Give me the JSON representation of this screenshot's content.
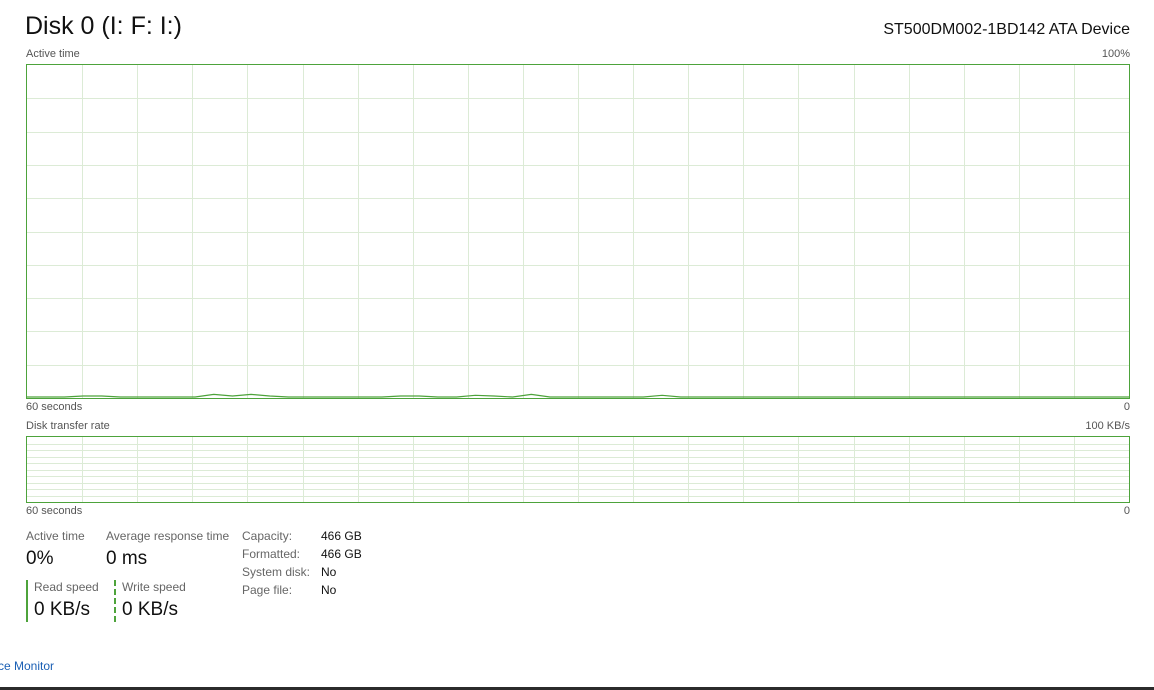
{
  "header": {
    "title": "Disk 0 (I: F: I:)",
    "device": "ST500DM002-1BD142 ATA Device"
  },
  "active_time_graph": {
    "label": "Active time",
    "max_label": "100%",
    "time_label": "60 seconds",
    "min_label": "0",
    "line_color": "#4da33b"
  },
  "transfer_graph": {
    "label": "Disk transfer rate",
    "max_label": "100 KB/s",
    "time_label": "60 seconds",
    "min_label": "0"
  },
  "stats": {
    "active_time_label": "Active time",
    "active_time_value": "0%",
    "avg_response_label": "Average response time",
    "avg_response_value": "0 ms",
    "read_speed_label": "Read speed",
    "read_speed_value": "0 KB/s",
    "write_speed_label": "Write speed",
    "write_speed_value": "0 KB/s"
  },
  "details": [
    {
      "label": "Capacity:",
      "value": "466 GB"
    },
    {
      "label": "Formatted:",
      "value": "466 GB"
    },
    {
      "label": "System disk:",
      "value": "No"
    },
    {
      "label": "Page file:",
      "value": "No"
    }
  ],
  "footer": {
    "link": "ce Monitor"
  },
  "chart_data": {
    "type": "line",
    "title": "Active time",
    "ylim": [
      0,
      100
    ],
    "xlabel": "60 seconds",
    "series": [
      {
        "values": [
          0,
          0,
          0,
          0.3,
          0.3,
          0,
          0,
          0,
          0,
          0,
          0.8,
          0.3,
          0.8,
          0.3,
          0,
          0,
          0,
          0,
          0,
          0,
          0.3,
          0.3,
          0,
          0,
          0.5,
          0.3,
          0,
          0.8,
          0,
          0,
          0,
          0,
          0,
          0,
          0.5,
          0,
          0,
          0,
          0,
          0,
          0,
          0,
          0,
          0,
          0,
          0,
          0,
          0,
          0,
          0,
          0,
          0,
          0,
          0,
          0,
          0,
          0,
          0,
          0,
          0
        ]
      }
    ]
  }
}
